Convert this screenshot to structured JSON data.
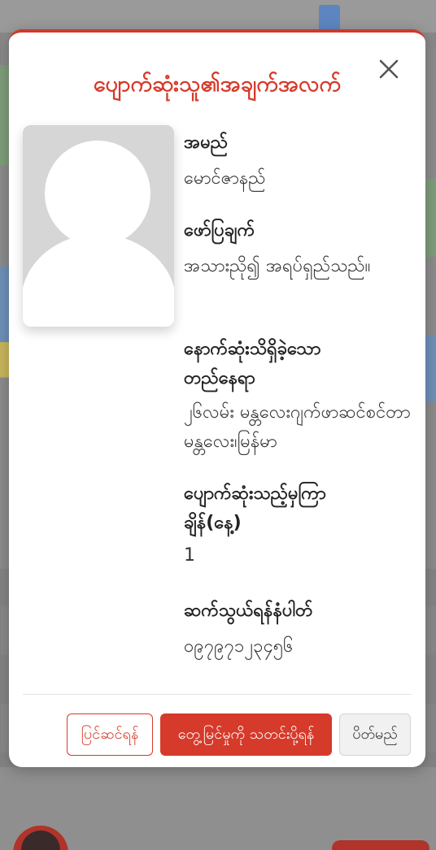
{
  "modal": {
    "title": "ပျောက်ဆုံးသူ၏အချက်အလက်",
    "fields": [
      {
        "label": "အမည်",
        "value": "မောင်ဇာနည်"
      },
      {
        "label": "ဖော်ပြချက်",
        "value": "အသားညို၍ အရပ်ရှည်သည်။"
      },
      {
        "label": "နောက်ဆုံးသိရှိခဲ့သောတည်နေရာ",
        "value": "၂၆လမ်း မန္တလေးဂျက်ဖာဆင်စင်တာ မန္တလေး၊မြန်မာ"
      },
      {
        "label": "ပျောက်ဆုံးသည့်မှကြာချိန်(နေ့)",
        "value": "1"
      },
      {
        "label": "ဆက်သွယ်ရန်နံပါတ်",
        "value": "၀၉၇၉၇၁၂၃၄၅၆"
      }
    ],
    "buttons": {
      "edit": "ပြင်ဆင်ရန်",
      "report": "တွေ့မြင်မှုကို သတင်းပို့ရန်",
      "close": "ပိတ်မည်"
    }
  },
  "icons": {
    "close": "close-icon",
    "avatar": "person-placeholder-icon"
  },
  "colors": {
    "accent": "#d63a2a",
    "title": "#d63a2a",
    "button_secondary_bg": "#f1f1f1"
  }
}
